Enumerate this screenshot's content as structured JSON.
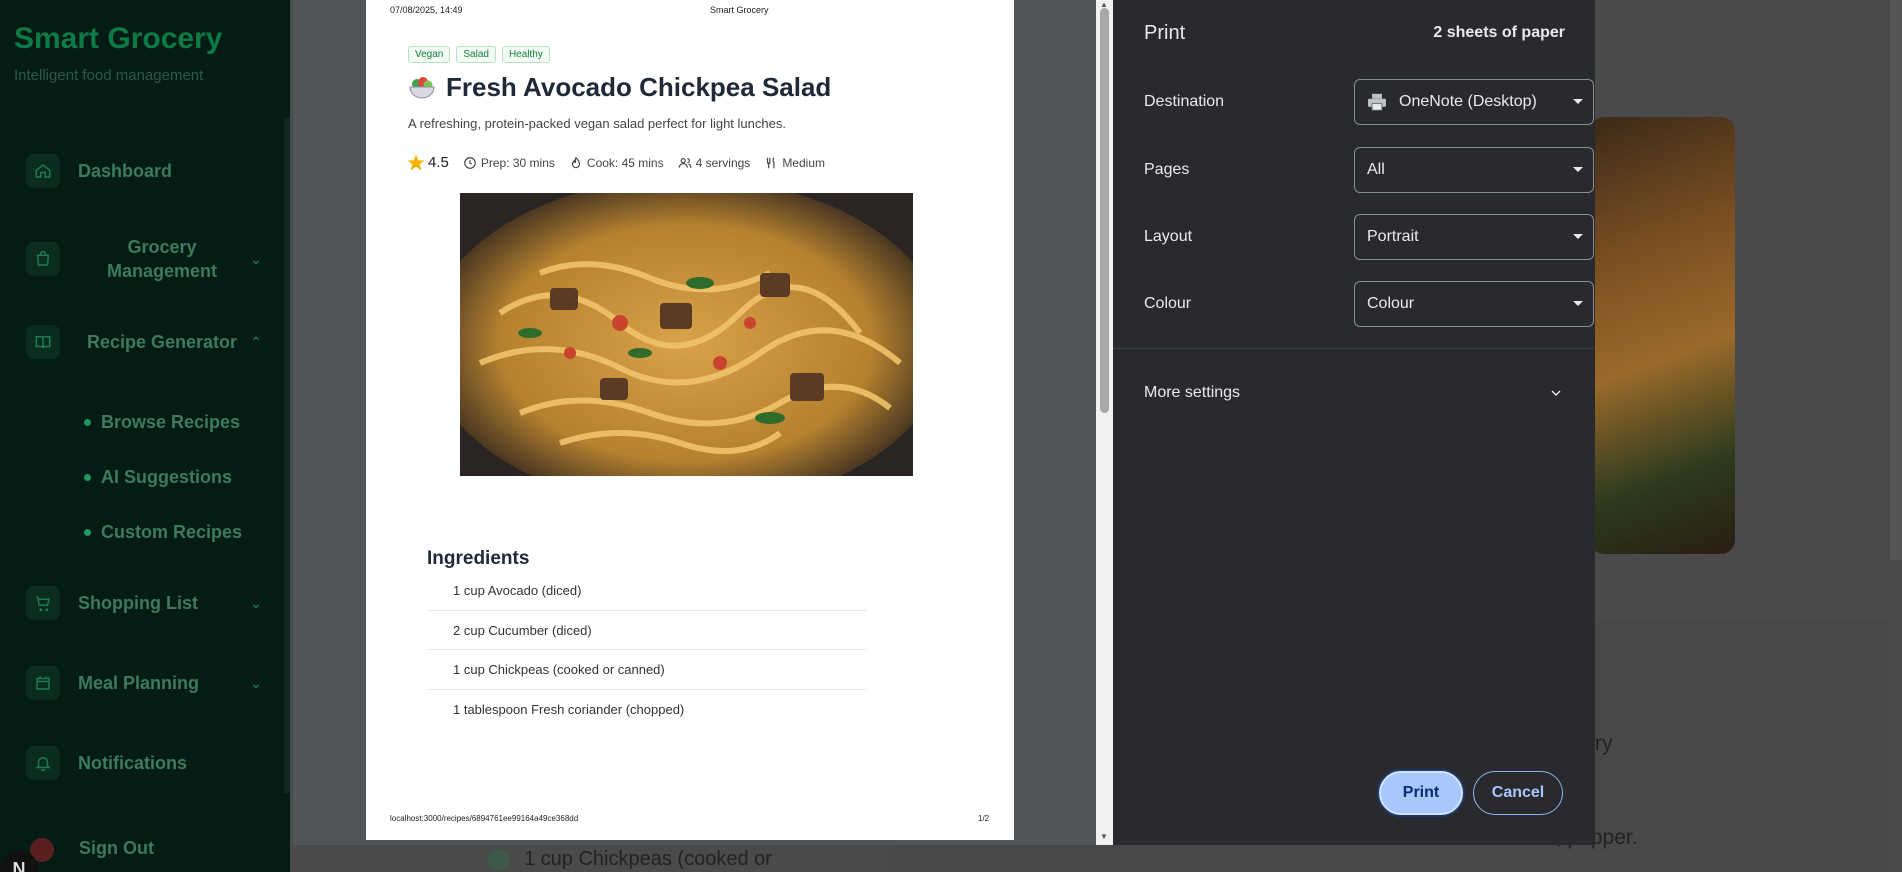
{
  "app": {
    "brand": "Smart Grocery",
    "tagline": "Intelligent food management",
    "nav": [
      {
        "label": "Dashboard"
      },
      {
        "label": "Grocery Management"
      },
      {
        "label": "Recipe Generator"
      },
      {
        "label": "Shopping List"
      },
      {
        "label": "Meal Planning"
      },
      {
        "label": "Notifications"
      },
      {
        "label": "Sign Out"
      }
    ],
    "recipe_sub": [
      "Browse Recipes",
      "AI Suggestions",
      "Custom Recipes"
    ],
    "avatar_initial": "N",
    "bg_text_right": "rry",
    "bg_text_bottom": "r, pepper.",
    "bg_bottom_item": "1 cup Chickpeas (cooked or"
  },
  "preview": {
    "header_date": "07/08/2025, 14:49",
    "header_title": "Smart Grocery",
    "tags": [
      "Vegan",
      "Salad",
      "Healthy"
    ],
    "title": "Fresh Avocado Chickpea Salad",
    "description": "A refreshing, protein-packed vegan salad perfect for light lunches.",
    "rating": "4.5",
    "prep": "Prep: 30 mins",
    "cook": "Cook: 45 mins",
    "servings": "4 servings",
    "difficulty": "Medium",
    "ingredients_title": "Ingredients",
    "ingredients": [
      "1 cup Avocado (diced)",
      "2 cup Cucumber (diced)",
      "1 cup Chickpeas (cooked or canned)",
      "1 tablespoon Fresh coriander (chopped)"
    ],
    "footer_url": "localhost:3000/recipes/6894761ee99164a49ce368dd",
    "footer_page": "1/2"
  },
  "settings": {
    "title": "Print",
    "sheets": "2 sheets of paper",
    "destination_label": "Destination",
    "destination_value": "OneNote (Desktop)",
    "pages_label": "Pages",
    "pages_value": "All",
    "layout_label": "Layout",
    "layout_value": "Portrait",
    "colour_label": "Colour",
    "colour_value": "Colour",
    "more_settings": "More settings",
    "print_button": "Print",
    "cancel_button": "Cancel"
  },
  "colors": {
    "brand_green": "#0e7a45",
    "dialog_bg": "#292a2d",
    "print_button": "#a8c7fa"
  }
}
